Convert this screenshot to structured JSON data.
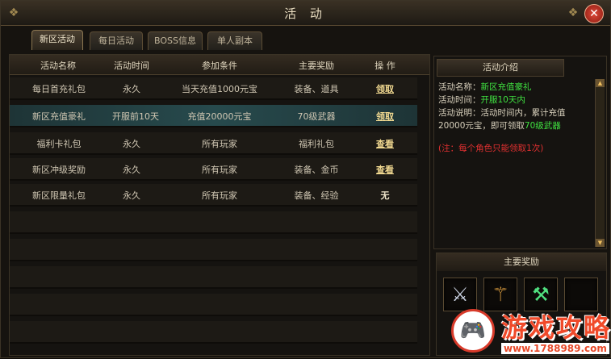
{
  "window": {
    "title": "活 动",
    "close_label": "✕"
  },
  "tabs": [
    "新区活动",
    "每日活动",
    "BOSS信息",
    "单人副本"
  ],
  "table": {
    "headers": [
      "活动名称",
      "活动时间",
      "参加条件",
      "主要奖励",
      "操 作"
    ],
    "rows": [
      {
        "name": "每日首充礼包",
        "time": "永久",
        "condition": "当天充值1000元宝",
        "reward": "装备、道具",
        "action": "领取",
        "action_type": "link"
      },
      {
        "name": "新区充值豪礼",
        "time": "开服前10天",
        "condition": "充值20000元宝",
        "reward": "70级武器",
        "action": "领取",
        "action_type": "link"
      },
      {
        "name": "福利卡礼包",
        "time": "永久",
        "condition": "所有玩家",
        "reward": "福利礼包",
        "action": "查看",
        "action_type": "link"
      },
      {
        "name": "新区冲级奖励",
        "time": "永久",
        "condition": "所有玩家",
        "reward": "装备、金币",
        "action": "查看",
        "action_type": "link"
      },
      {
        "name": "新区限量礼包",
        "time": "永久",
        "condition": "所有玩家",
        "reward": "装备、经验",
        "action": "无",
        "action_type": "text"
      }
    ]
  },
  "intro": {
    "header": "活动介绍",
    "name_label": "活动名称：",
    "name_value": "新区充值豪礼",
    "time_label": "活动时间：",
    "time_value": "开服10天内",
    "desc_label": "活动说明：",
    "desc_text_1": "活动时间内，累计充值",
    "desc_text_2": "20000元宝，即可领取",
    "desc_value": "70级武器",
    "note": "(注：每个角色只能领取1次)"
  },
  "rewards": {
    "header": "主要奖励",
    "items": [
      "weapon-sword-icon",
      "weapon-staff-icon",
      "weapon-axe-icon",
      "weapon-empty-slot"
    ]
  },
  "watermark": {
    "title": "游戏攻略",
    "url": "www.1788989.com"
  },
  "colors": {
    "highlight": "#3fe040",
    "note": "#e03030",
    "link": "#f0d890",
    "selected_row": "#274a4d"
  }
}
